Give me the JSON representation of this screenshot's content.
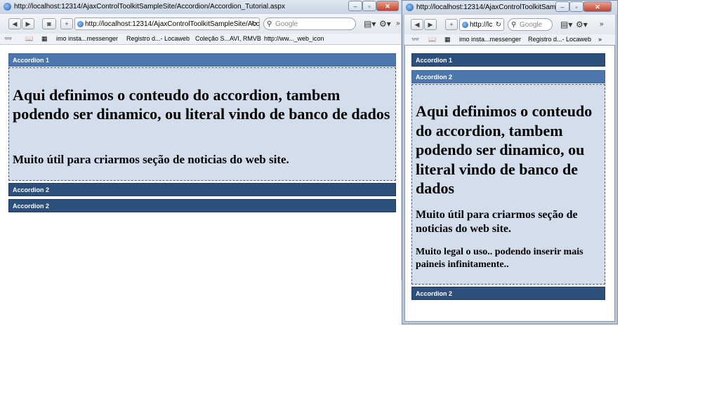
{
  "window1": {
    "title": "http://localhost:12314/AjaxControlToolkitSampleSite/Accordion/Accordion_Tutorial.aspx",
    "address": "http://localhost:12314/AjaxControlToolkitSampleSite/Acco",
    "search_placeholder": "Google",
    "bookmarks": [
      "imo insta...messenger",
      "Registro d...- Locaweb",
      "Coleção S...AVI, RMVB",
      "http://ww..._web_icon"
    ],
    "accordion": [
      {
        "header": "Accordion 1",
        "selected": true
      },
      {
        "header": "Accordion 2",
        "selected": false
      },
      {
        "header": "Accordion 2",
        "selected": false
      }
    ],
    "content": {
      "heading": "Aqui definimos o conteudo do accordion, tambem podendo ser dinamico, ou literal vindo de banco de dados",
      "subheading": "Muito útil para criarmos seção de noticias do web site."
    }
  },
  "window2": {
    "title": "http://localhost:12314/AjaxControlToolkitSamp...",
    "address": "http://lc",
    "search_placeholder": "Google",
    "bookmarks": [
      "imo insta...messenger",
      "Registro d...- Locaweb"
    ],
    "accordion": [
      {
        "header": "Accordion 1",
        "selected": false
      },
      {
        "header": "Accordion 2",
        "selected": true
      },
      {
        "header": "Accordion 2",
        "selected": false
      }
    ],
    "content": {
      "heading": "Aqui definimos o conteudo do accordion, tambem podendo ser dinamico, ou literal vindo de banco de dados",
      "subheading": "Muito útil para criarmos seção de noticias do web site.",
      "note": "Muito legal o uso.. podendo inserir mais paineis infinitamente.."
    }
  },
  "colors": {
    "header_collapsed": "#2c4f7c",
    "header_selected": "#4d76ad",
    "content_bg": "#d3ddec"
  }
}
